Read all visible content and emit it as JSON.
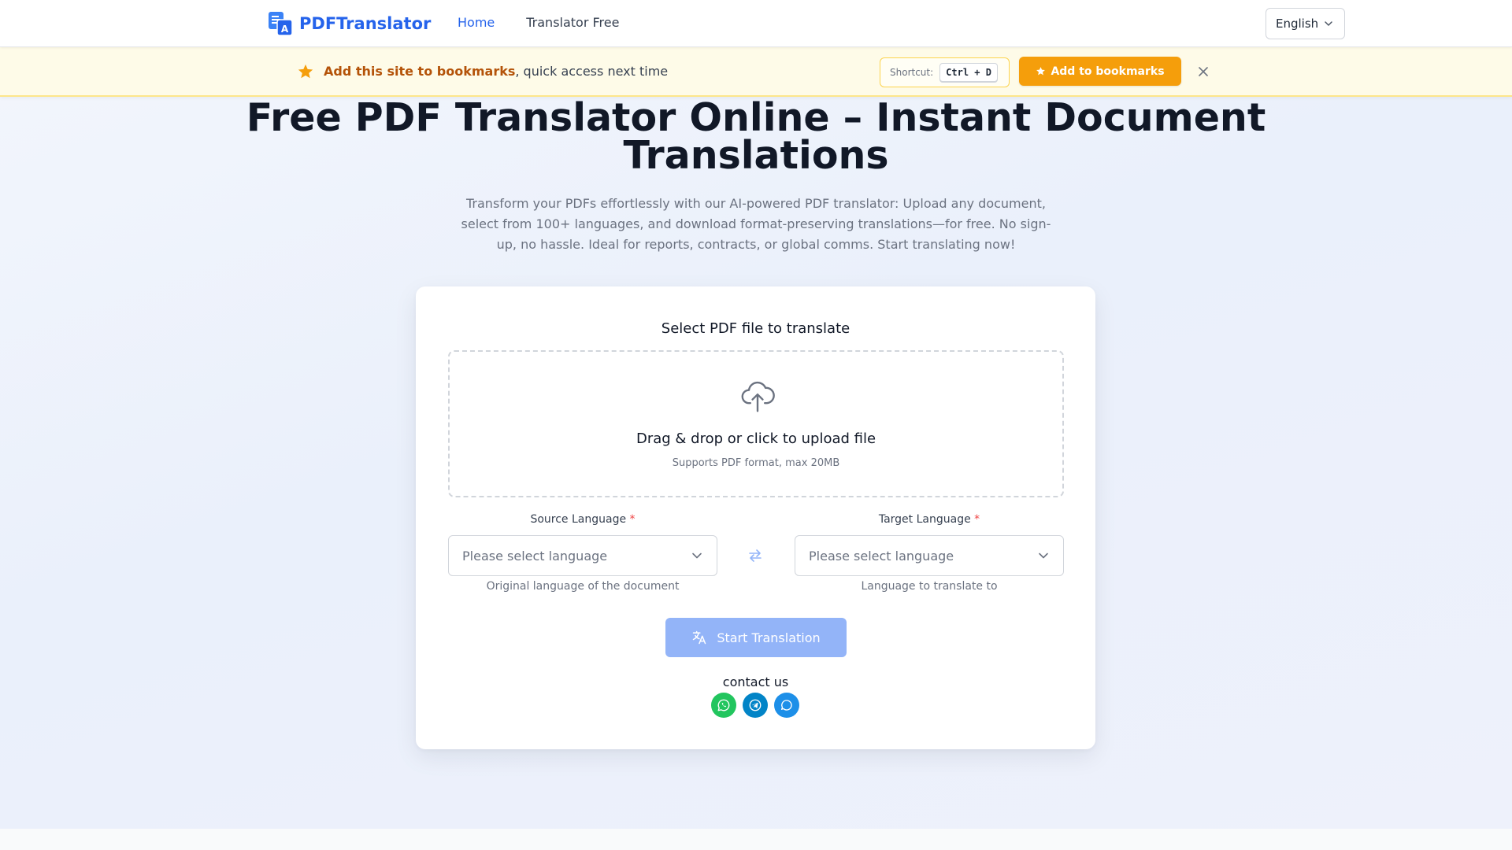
{
  "header": {
    "logo_text": "PDFTranslator",
    "nav": [
      {
        "label": "Home",
        "active": true
      },
      {
        "label": "Translator Free",
        "active": false
      }
    ],
    "language": "English"
  },
  "banner": {
    "bold_text": "Add this site to bookmarks",
    "rest_text": ", quick access next time",
    "shortcut_label": "Shortcut:",
    "shortcut_keys": "Ctrl + D",
    "button_label": "Add to bookmarks"
  },
  "hero": {
    "title": "Free PDF Translator Online – Instant Document Translations",
    "description": "Transform your PDFs effortlessly with our AI-powered PDF translator: Upload any document, select from 100+ languages, and download format-preserving translations—for free. No sign-up, no hassle. Ideal for reports, contracts, or global comms. Start translating now!"
  },
  "card": {
    "title": "Select PDF file to translate",
    "dropzone": {
      "main_text": "Drag & drop or click to upload file",
      "sub_text": "Supports PDF format, max 20MB"
    },
    "source": {
      "label": "Source Language",
      "required": "*",
      "placeholder": "Please select language",
      "hint": "Original language of the document"
    },
    "target": {
      "label": "Target Language",
      "required": "*",
      "placeholder": "Please select language",
      "hint": "Language to translate to"
    },
    "start_button": "Start Translation",
    "contact_label": "contact us",
    "social": [
      {
        "icon": "whatsapp-icon",
        "color": "#22c55e"
      },
      {
        "icon": "telegram-icon",
        "color": "#0284c7"
      },
      {
        "icon": "chat-icon",
        "color": "#1d8fe8"
      }
    ]
  },
  "colors": {
    "brand": "#2563eb",
    "banner_accent": "#b45309",
    "bookmark_button": "#f59e0b",
    "start_button_disabled": "#93b4f8",
    "required": "#ef4444"
  }
}
